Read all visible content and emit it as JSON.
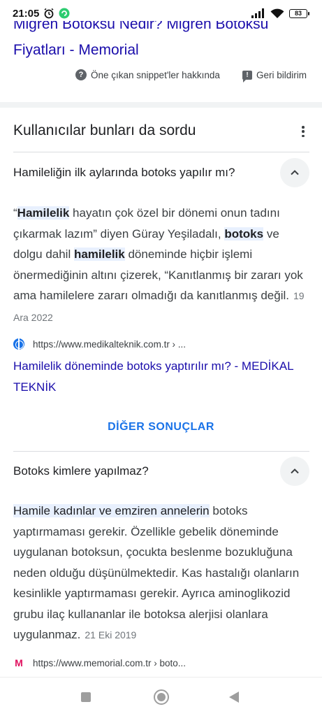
{
  "status_bar": {
    "time": "21:05",
    "battery": "83"
  },
  "top_result": {
    "title_clipped": "Migren Botoksu Nedir? Migren Botoksu",
    "title_line2": "Fiyatları - Memorial"
  },
  "snippet_bar": {
    "about_label": "Öne çıkan snippet'ler hakkında",
    "feedback_label": "Geri bildirim"
  },
  "paa": {
    "title": "Kullanıcılar bunları da sordu",
    "q1": {
      "question": "Hamileliğin ilk aylarında botoks yapılır mı?",
      "answer_parts": {
        "p1": "“",
        "h1": "Hamilelik",
        "p2": " hayatın çok özel bir dönemi onun tadını çıkarmak lazım” diyen Güray Yeşiladalı, ",
        "h2": "botoks",
        "p3": " ve dolgu dahil ",
        "h3": "hamilelik",
        "p4": " döneminde hiçbir işlemi önermediğinin altını çizerek, “Kanıtlanmış bir zararı yok ama hamilelere zararı olmadığı da kanıtlanmış değil."
      },
      "date": "19 Ara 2022",
      "source_url": "https://www.medikalteknik.com.tr › ...",
      "link_title": "Hamilelik döneminde botoks yaptırılır mı? - MEDİKAL TEKNİK"
    },
    "more_results": "DİĞER SONUÇLAR",
    "q2": {
      "question": "Botoks kimlere yapılmaz?",
      "answer_highlight": "Hamile kadınlar ve emziren annelerin",
      "answer_rest": " botoks yaptırmaması gerekir. Özellikle gebelik döneminde uygulanan botoksun, çocukta beslenme bozukluğuna neden olduğu düşünülmektedir. Kas hastalığı olanların kesinlikle yaptırmaması gerekir. Ayrıca aminoglikozid grubu ilaç kullananlar ile botoksa alerjisi olanlara uygulanmaz.",
      "date": "21 Eki 2019",
      "source_url": "https://www.memorial.com.tr › boto..."
    }
  },
  "colors": {
    "link": "#1a0dab",
    "accent": "#1a73e8",
    "highlight": "#e8f0fe"
  }
}
